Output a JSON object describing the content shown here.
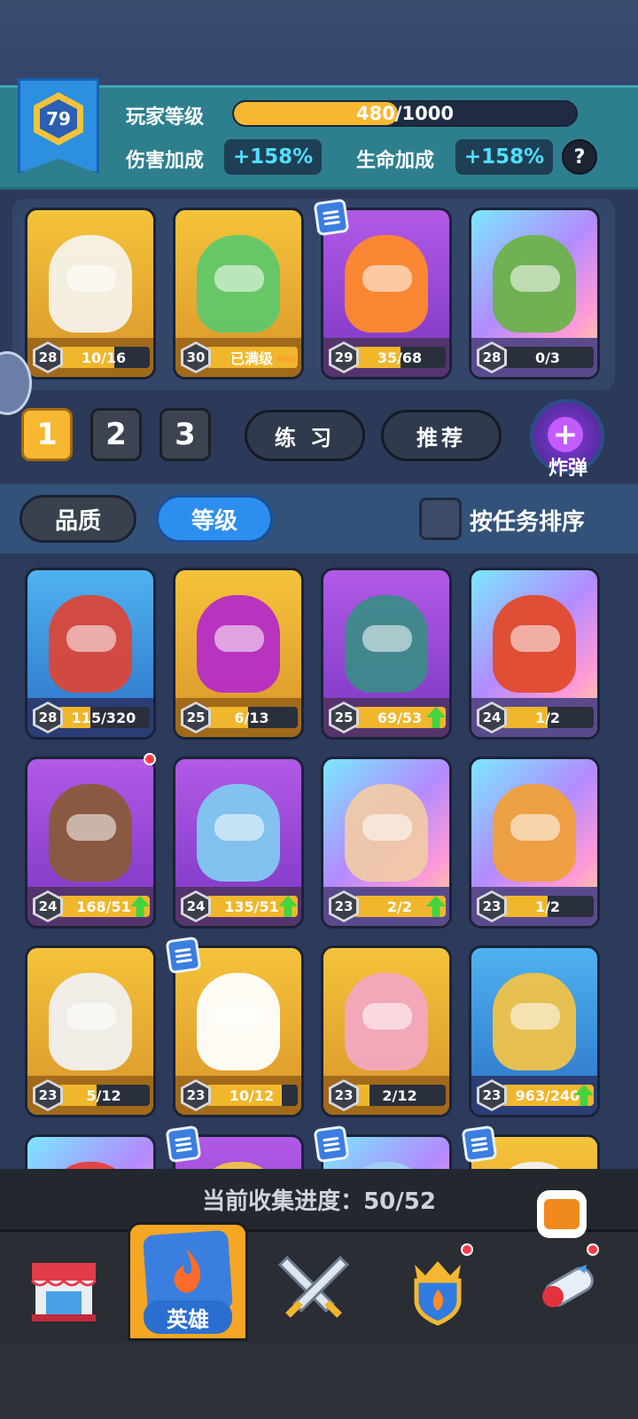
{
  "header": {
    "player_level": "79",
    "player_level_label": "玩家等级",
    "xp_text": "480/1000",
    "xp_progress": 0.48,
    "damage_bonus_label": "伤害加成",
    "damage_bonus_value": "+158%",
    "hp_bonus_label": "生命加成",
    "hp_bonus_value": "+158%",
    "help_icon": "question-icon",
    "help_text": "?"
  },
  "deck": [
    {
      "level": "28",
      "progress": "10/16",
      "fill": 0.62,
      "rarity": "gold",
      "color": "#f5f2ea",
      "max": "",
      "arrow": false,
      "task": false
    },
    {
      "level": "30",
      "progress": "已满级",
      "fill": 1.0,
      "rarity": "gold",
      "color": "#5fc86a",
      "max": "Max",
      "arrow": false,
      "task": false
    },
    {
      "level": "29",
      "progress": "35/68",
      "fill": 0.51,
      "rarity": "purple",
      "color": "#ff8a2a",
      "max": "",
      "arrow": false,
      "task": true
    },
    {
      "level": "28",
      "progress": "0/3",
      "fill": 0.0,
      "rarity": "rainbow",
      "color": "#6bb24a",
      "max": "",
      "arrow": false,
      "task": false
    }
  ],
  "deck_tabs": [
    "1",
    "2",
    "3"
  ],
  "deck_tab_active": 0,
  "practice_label": "练 习",
  "recommend_label": "推荐",
  "bomb_label": "炸弹",
  "bomb_plus": "+",
  "filters": {
    "quality_label": "品质",
    "level_label": "等级",
    "sort_by_task_label": "按任务排序"
  },
  "collection": [
    {
      "level": "28",
      "progress": "115/320",
      "fill": 0.36,
      "rarity": "blue",
      "color": "#d9473a",
      "arrow": false,
      "task": false,
      "dot": false
    },
    {
      "level": "25",
      "progress": "6/13",
      "fill": 0.46,
      "rarity": "gold",
      "color": "#b52cc7",
      "arrow": false,
      "task": false,
      "dot": false
    },
    {
      "level": "25",
      "progress": "69/53",
      "fill": 1.0,
      "rarity": "purple",
      "color": "#3d8a8a",
      "arrow": true,
      "task": false,
      "dot": false
    },
    {
      "level": "24",
      "progress": "1/2",
      "fill": 0.5,
      "rarity": "rainbow",
      "color": "#e24a2a",
      "arrow": false,
      "task": false,
      "dot": false
    },
    {
      "level": "24",
      "progress": "168/51",
      "fill": 1.0,
      "rarity": "purple",
      "color": "#8a5a3a",
      "arrow": true,
      "task": false,
      "dot": true
    },
    {
      "level": "24",
      "progress": "135/51",
      "fill": 1.0,
      "rarity": "purple",
      "color": "#7fc8f0",
      "arrow": true,
      "task": false,
      "dot": false
    },
    {
      "level": "23",
      "progress": "2/2",
      "fill": 1.0,
      "rarity": "rainbow",
      "color": "#f0c9a8",
      "arrow": true,
      "task": false,
      "dot": false
    },
    {
      "level": "23",
      "progress": "1/2",
      "fill": 0.5,
      "rarity": "rainbow",
      "color": "#f0a03a",
      "arrow": false,
      "task": false,
      "dot": false
    },
    {
      "level": "23",
      "progress": "5/12",
      "fill": 0.42,
      "rarity": "gold",
      "color": "#f0f0f0",
      "arrow": false,
      "task": false,
      "dot": false
    },
    {
      "level": "23",
      "progress": "10/12",
      "fill": 0.83,
      "rarity": "gold",
      "color": "#ffffff",
      "arrow": false,
      "task": true,
      "dot": false
    },
    {
      "level": "23",
      "progress": "2/12",
      "fill": 0.17,
      "rarity": "gold",
      "color": "#f2a8c0",
      "arrow": false,
      "task": false,
      "dot": false
    },
    {
      "level": "23",
      "progress": "963/240",
      "fill": 1.0,
      "rarity": "blue",
      "color": "#f0c24a",
      "arrow": true,
      "task": false,
      "dot": false
    },
    {
      "level": "",
      "progress": "",
      "fill": 0,
      "rarity": "rainbow",
      "color": "#e0403a",
      "arrow": false,
      "task": false,
      "dot": false
    },
    {
      "level": "",
      "progress": "",
      "fill": 0,
      "rarity": "purple",
      "color": "#f0c24a",
      "arrow": false,
      "task": true,
      "dot": false
    },
    {
      "level": "",
      "progress": "",
      "fill": 0,
      "rarity": "rainbow",
      "color": "#a0d0f0",
      "arrow": false,
      "task": true,
      "dot": false
    },
    {
      "level": "",
      "progress": "",
      "fill": 0,
      "rarity": "gold",
      "color": "#f0f0f0",
      "arrow": false,
      "task": true,
      "dot": false
    }
  ],
  "collection_progress_text": "当前收集进度：50/52",
  "nav": {
    "shop_icon": "shop-icon",
    "heroes_label": "英雄",
    "battle_icon": "crossed-swords-icon",
    "clan_icon": "crown-shield-icon",
    "events_icon": "rocket-icon"
  }
}
